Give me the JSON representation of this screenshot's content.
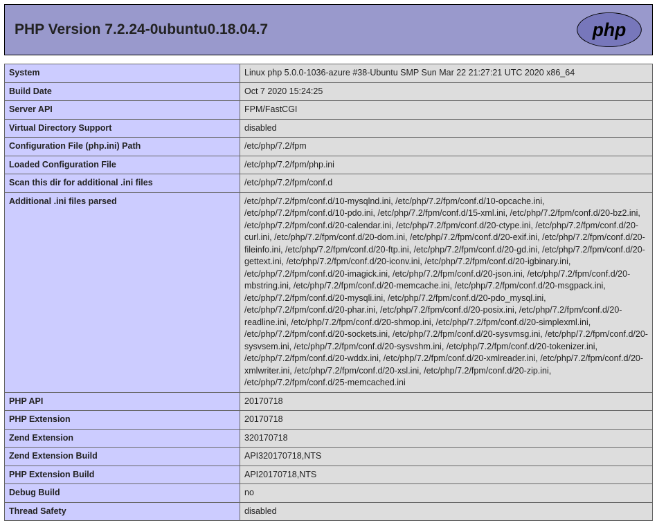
{
  "header": {
    "title": "PHP Version 7.2.24-0ubuntu0.18.04.7"
  },
  "rows": [
    {
      "label": "System",
      "value": "Linux php 5.0.0-1036-azure #38-Ubuntu SMP Sun Mar 22 21:27:21 UTC 2020 x86_64"
    },
    {
      "label": "Build Date",
      "value": "Oct 7 2020 15:24:25"
    },
    {
      "label": "Server API",
      "value": "FPM/FastCGI"
    },
    {
      "label": "Virtual Directory Support",
      "value": "disabled"
    },
    {
      "label": "Configuration File (php.ini) Path",
      "value": "/etc/php/7.2/fpm"
    },
    {
      "label": "Loaded Configuration File",
      "value": "/etc/php/7.2/fpm/php.ini"
    },
    {
      "label": "Scan this dir for additional .ini files",
      "value": "/etc/php/7.2/fpm/conf.d"
    },
    {
      "label": "Additional .ini files parsed",
      "value": "/etc/php/7.2/fpm/conf.d/10-mysqlnd.ini, /etc/php/7.2/fpm/conf.d/10-opcache.ini, /etc/php/7.2/fpm/conf.d/10-pdo.ini, /etc/php/7.2/fpm/conf.d/15-xml.ini, /etc/php/7.2/fpm/conf.d/20-bz2.ini, /etc/php/7.2/fpm/conf.d/20-calendar.ini, /etc/php/7.2/fpm/conf.d/20-ctype.ini, /etc/php/7.2/fpm/conf.d/20-curl.ini, /etc/php/7.2/fpm/conf.d/20-dom.ini, /etc/php/7.2/fpm/conf.d/20-exif.ini, /etc/php/7.2/fpm/conf.d/20-fileinfo.ini, /etc/php/7.2/fpm/conf.d/20-ftp.ini, /etc/php/7.2/fpm/conf.d/20-gd.ini, /etc/php/7.2/fpm/conf.d/20-gettext.ini, /etc/php/7.2/fpm/conf.d/20-iconv.ini, /etc/php/7.2/fpm/conf.d/20-igbinary.ini, /etc/php/7.2/fpm/conf.d/20-imagick.ini, /etc/php/7.2/fpm/conf.d/20-json.ini, /etc/php/7.2/fpm/conf.d/20-mbstring.ini, /etc/php/7.2/fpm/conf.d/20-memcache.ini, /etc/php/7.2/fpm/conf.d/20-msgpack.ini, /etc/php/7.2/fpm/conf.d/20-mysqli.ini, /etc/php/7.2/fpm/conf.d/20-pdo_mysql.ini, /etc/php/7.2/fpm/conf.d/20-phar.ini, /etc/php/7.2/fpm/conf.d/20-posix.ini, /etc/php/7.2/fpm/conf.d/20-readline.ini, /etc/php/7.2/fpm/conf.d/20-shmop.ini, /etc/php/7.2/fpm/conf.d/20-simplexml.ini, /etc/php/7.2/fpm/conf.d/20-sockets.ini, /etc/php/7.2/fpm/conf.d/20-sysvmsg.ini, /etc/php/7.2/fpm/conf.d/20-sysvsem.ini, /etc/php/7.2/fpm/conf.d/20-sysvshm.ini, /etc/php/7.2/fpm/conf.d/20-tokenizer.ini, /etc/php/7.2/fpm/conf.d/20-wddx.ini, /etc/php/7.2/fpm/conf.d/20-xmlreader.ini, /etc/php/7.2/fpm/conf.d/20-xmlwriter.ini, /etc/php/7.2/fpm/conf.d/20-xsl.ini, /etc/php/7.2/fpm/conf.d/20-zip.ini, /etc/php/7.2/fpm/conf.d/25-memcached.ini"
    },
    {
      "label": "PHP API",
      "value": "20170718"
    },
    {
      "label": "PHP Extension",
      "value": "20170718"
    },
    {
      "label": "Zend Extension",
      "value": "320170718"
    },
    {
      "label": "Zend Extension Build",
      "value": "API320170718,NTS"
    },
    {
      "label": "PHP Extension Build",
      "value": "API20170718,NTS"
    },
    {
      "label": "Debug Build",
      "value": "no"
    },
    {
      "label": "Thread Safety",
      "value": "disabled"
    }
  ]
}
